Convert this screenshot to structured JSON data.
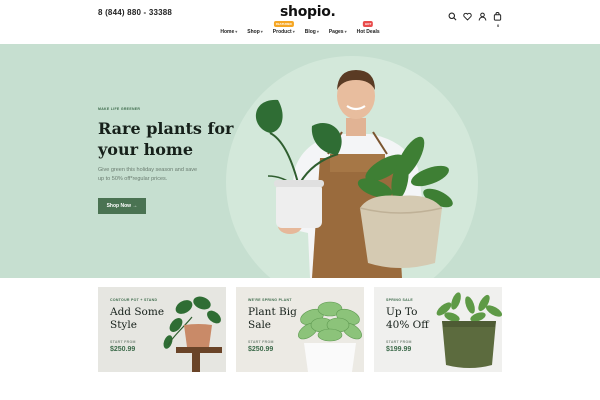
{
  "header": {
    "phone": "8 (844) 880 - 33388",
    "logo": "shopio.",
    "cart_count": "0"
  },
  "nav": {
    "items": [
      {
        "label": "Home",
        "has_dropdown": true
      },
      {
        "label": "Shop",
        "has_dropdown": true
      },
      {
        "label": "Product",
        "has_dropdown": true,
        "badge": "FEATURED",
        "badge_color": "#f5a623"
      },
      {
        "label": "Blog",
        "has_dropdown": true
      },
      {
        "label": "Pages",
        "has_dropdown": true
      },
      {
        "label": "Hot Deals",
        "has_dropdown": false,
        "badge": "HOT",
        "badge_color": "#e94b4b"
      }
    ]
  },
  "hero": {
    "tag": "MAKE LIFE GREENER",
    "title_line1": "Rare plants for",
    "title_line2": "your home",
    "desc_line1": "Give green this holiday season and save",
    "desc_line2": "up to 50% off*regular prices.",
    "button_label": "Shop Now",
    "arrow": "→"
  },
  "cards": [
    {
      "tag": "CONTOUR POT + STAND",
      "title_line1": "Add Some",
      "title_line2": "Style",
      "from": "START FROM",
      "price": "$250.99",
      "bg": "#e6e6e1"
    },
    {
      "tag": "WE'RE SPRING PLANT",
      "title_line1": "Plant Big",
      "title_line2": "Sale",
      "from": "START FROM",
      "price": "$250.99",
      "bg": "#eceae4"
    },
    {
      "tag": "SPRING SALE",
      "title_line1": "Up To",
      "title_line2": "40% Off",
      "from": "START FROM",
      "price": "$199.99",
      "bg": "#f0f0ee"
    }
  ],
  "colors": {
    "accent": "#4a7352",
    "hero_bg": "#c6dfd0"
  }
}
